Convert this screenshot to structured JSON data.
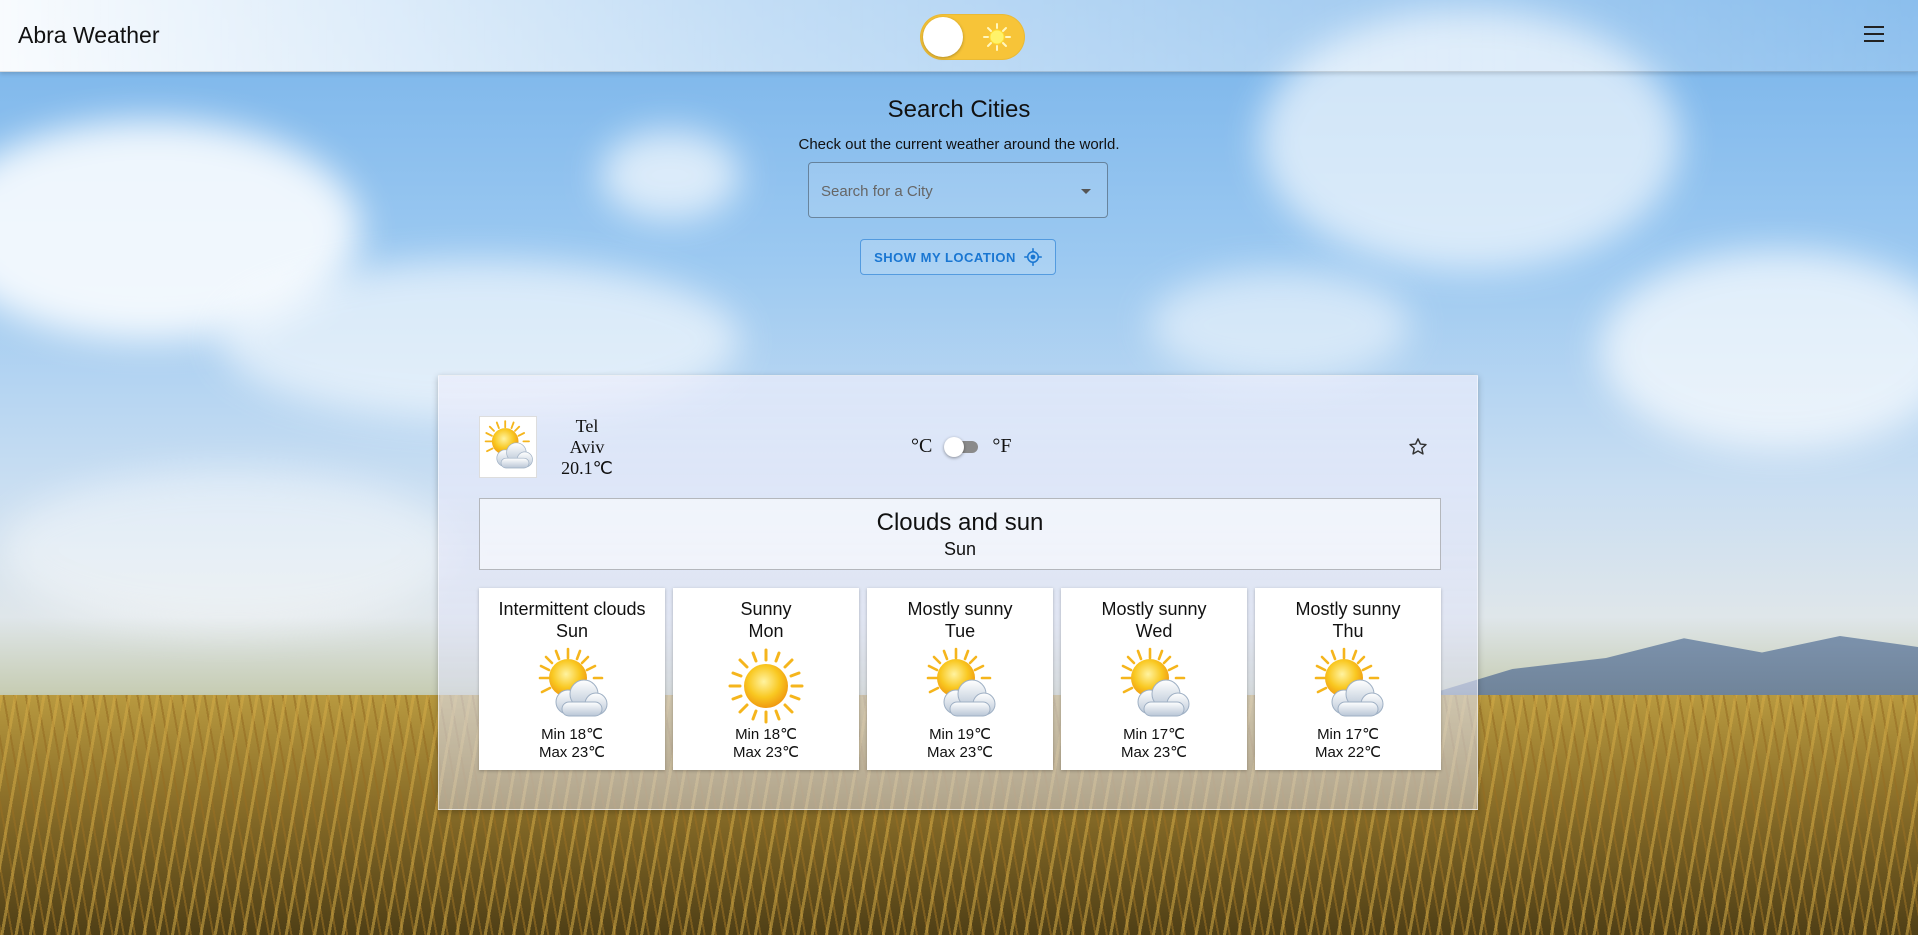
{
  "app": {
    "title": "Abra Weather"
  },
  "header": {
    "theme_toggle": "light-mode-sun",
    "menu_icon": "hamburger-menu"
  },
  "search": {
    "title": "Search Cities",
    "subtitle": "Check out the current weather around the world.",
    "placeholder": "Search for a City",
    "location_button": "SHOW MY LOCATION"
  },
  "current": {
    "city_line1": "Tel",
    "city_line2": "Aviv",
    "temperature": "20.1℃",
    "unit_c": "°C",
    "unit_f": "°F",
    "unit_selected": "C",
    "description": "Clouds and sun",
    "day": "Sun",
    "icon": "partly-sunny"
  },
  "forecast": [
    {
      "desc": "Intermittent clouds",
      "day": "Sun",
      "min": "Min 18℃",
      "max": "Max 23℃",
      "icon": "partly-sunny"
    },
    {
      "desc": "Sunny",
      "day": "Mon",
      "min": "Min 18℃",
      "max": "Max 23℃",
      "icon": "sunny"
    },
    {
      "desc": "Mostly sunny",
      "day": "Tue",
      "min": "Min 19℃",
      "max": "Max 23℃",
      "icon": "partly-sunny"
    },
    {
      "desc": "Mostly sunny",
      "day": "Wed",
      "min": "Min 17℃",
      "max": "Max 23℃",
      "icon": "partly-sunny"
    },
    {
      "desc": "Mostly sunny",
      "day": "Thu",
      "min": "Min 17℃",
      "max": "Max 22℃",
      "icon": "partly-sunny"
    }
  ],
  "colors": {
    "accent": "#1976d2",
    "toggle": "#f7c438"
  }
}
